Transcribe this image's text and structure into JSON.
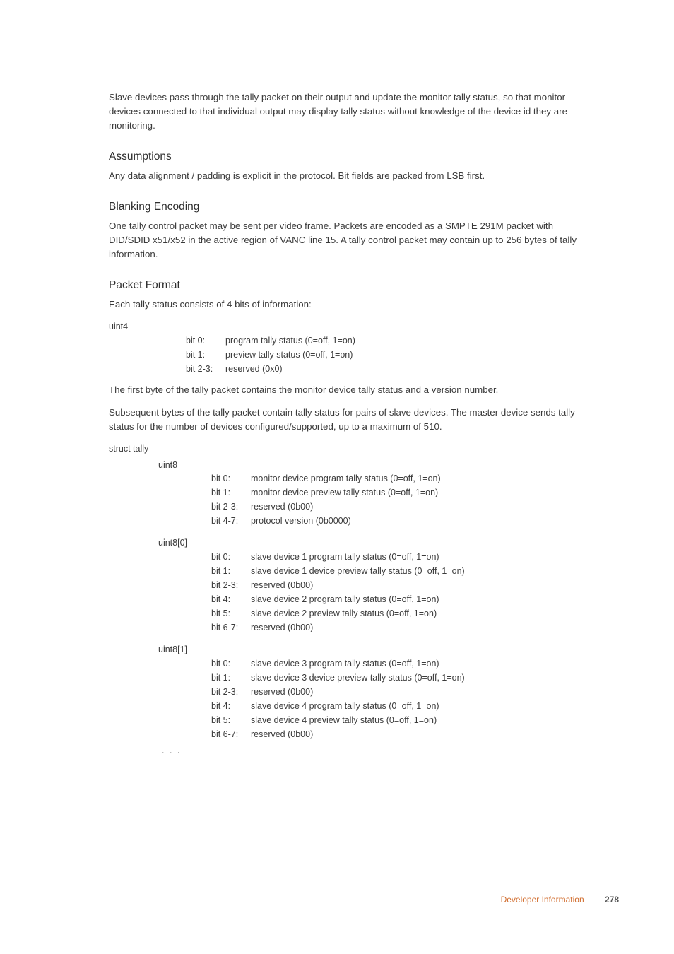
{
  "intro_para": "Slave devices pass through the tally packet on their output and update the monitor tally status, so that monitor devices connected to that individual output may display tally status without knowledge of the device id they are monitoring.",
  "assumptions": {
    "heading": "Assumptions",
    "para": "Any data alignment / padding is explicit in the protocol. Bit fields are packed from LSB first."
  },
  "blanking": {
    "heading": "Blanking Encoding",
    "para": "One tally control packet may be sent per video frame. Packets are encoded as a SMPTE 291M packet with DID/SDID x51/x52 in the active region of VANC line 15. A tally control packet may contain up to 256 bytes of tally information."
  },
  "packet": {
    "heading": "Packet Format",
    "intro": "Each tally status consists of 4 bits of information:",
    "uint4_label": "uint4",
    "uint4_rows": [
      {
        "k": "bit 0:",
        "v": "program tally status (0=off, 1=on)"
      },
      {
        "k": "bit 1:",
        "v": "preview tally status (0=off, 1=on)"
      },
      {
        "k": "bit 2-3:",
        "v": "reserved (0x0)"
      }
    ],
    "mid_para1": "The first byte of the tally packet contains the monitor device tally status and a version number.",
    "mid_para2": "Subsequent bytes of the tally packet contain tally status for pairs of slave devices. The master device sends tally status for the number of devices configured/supported, up to a maximum of 510.",
    "struct_label": "struct tally",
    "sections": [
      {
        "type": "uint8",
        "rows": [
          {
            "k": "bit 0:",
            "v": "monitor device program tally status (0=off, 1=on)"
          },
          {
            "k": "bit 1:",
            "v": "monitor device preview tally status (0=off, 1=on)"
          },
          {
            "k": "bit 2-3:",
            "v": "reserved (0b00)"
          },
          {
            "k": "bit 4-7:",
            "v": "protocol version (0b0000)"
          }
        ]
      },
      {
        "type": "uint8[0]",
        "rows": [
          {
            "k": "bit 0:",
            "v": "slave device 1 program tally status (0=off, 1=on)"
          },
          {
            "k": "bit 1:",
            "v": "slave device 1 device preview tally status (0=off, 1=on)"
          },
          {
            "k": "bit 2-3:",
            "v": "reserved (0b00)"
          },
          {
            "k": "bit 4:",
            "v": "slave device 2 program tally status (0=off, 1=on)"
          },
          {
            "k": "bit 5:",
            "v": "slave device 2 preview tally status (0=off, 1=on)"
          },
          {
            "k": "bit 6-7:",
            "v": "reserved (0b00)"
          }
        ]
      },
      {
        "type": "uint8[1]",
        "rows": [
          {
            "k": "bit 0:",
            "v": "slave device 3 program tally status (0=off, 1=on)"
          },
          {
            "k": "bit 1:",
            "v": "slave device 3 device preview tally status (0=off, 1=on)"
          },
          {
            "k": "bit 2-3:",
            "v": "reserved (0b00)"
          },
          {
            "k": "bit 4:",
            "v": "slave device 4 program tally status (0=off, 1=on)"
          },
          {
            "k": "bit 5:",
            "v": "slave device 4 preview tally status (0=off, 1=on)"
          },
          {
            "k": "bit 6-7:",
            "v": "reserved (0b00)"
          }
        ]
      }
    ],
    "ellipsis": ". . ."
  },
  "footer": {
    "section": "Developer Information",
    "page": "278"
  }
}
